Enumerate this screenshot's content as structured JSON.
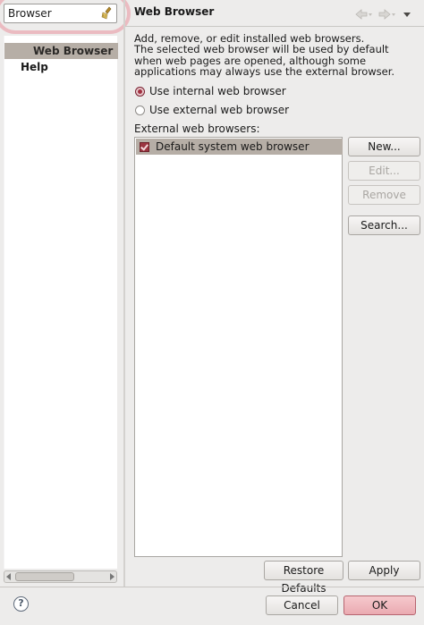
{
  "filter": {
    "value": "Browser",
    "clear_icon": "clear-broom-icon"
  },
  "tree": {
    "items": [
      {
        "label": "Web Browser",
        "selected": true
      },
      {
        "label": "Help",
        "selected": false
      }
    ]
  },
  "page": {
    "title": "Web Browser",
    "nav_back_icon": "back-arrow-icon",
    "nav_forward_icon": "forward-arrow-icon",
    "nav_menu_icon": "chevron-down-icon",
    "description": "Add, remove, or edit installed web browsers.\nThe selected web browser will be used by default when web pages are opened, although some applications may always use the external browser.",
    "radio_internal": "Use internal web browser",
    "radio_external": "Use external web browser",
    "selected_mode": "internal",
    "list_label": "External web browsers:",
    "browsers": [
      {
        "label": "Default system web browser",
        "checked": true
      }
    ],
    "buttons": {
      "new": "New...",
      "edit": "Edit...",
      "remove": "Remove",
      "search": "Search..."
    },
    "restore_defaults": "Restore Defaults",
    "apply": "Apply"
  },
  "dialog": {
    "help_icon": "help-icon",
    "cancel": "Cancel",
    "ok": "OK"
  },
  "colors": {
    "selection": "#b6aea6",
    "accent": "#eaaab1",
    "radio_checked": "#a03040"
  }
}
